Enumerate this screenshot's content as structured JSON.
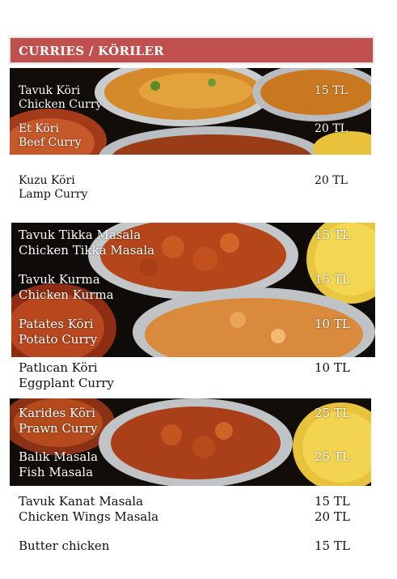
{
  "section": {
    "title": "CURRIES / KÖRILER"
  },
  "items": [
    {
      "tr": "Tavuk Köri",
      "en": "Chicken Curry",
      "price": "15 TL"
    },
    {
      "tr": "Et Köri",
      "en": "Beef Curry",
      "price": "20 TL"
    },
    {
      "tr": "Kuzu Köri",
      "en": "Lamp Curry",
      "price": "20 TL"
    },
    {
      "tr": "Tavuk Tikka Masala",
      "en": "Chicken Tikka Masala",
      "price": "15 TL"
    },
    {
      "tr": "Tavuk Kurma",
      "en": "Chicken Kurma",
      "price": "15 TL"
    },
    {
      "tr": "Patates Köri",
      "en": "Potato Curry",
      "price": "10 TL"
    },
    {
      "tr": "Patlıcan Köri",
      "en": "Eggplant Curry",
      "price": "10 TL"
    },
    {
      "tr": "Karides Köri",
      "en": "Prawn Curry",
      "price": "25 TL"
    },
    {
      "tr": "Balık Masala",
      "en": "Fish Masala",
      "price": "25 TL"
    },
    {
      "tr": "Tavuk Kanat Masala",
      "en": "Chicken Wings Masala",
      "price": "15 TL",
      "price2": "20 TL"
    },
    {
      "tr": "Butter chicken",
      "price": "15 TL"
    }
  ]
}
